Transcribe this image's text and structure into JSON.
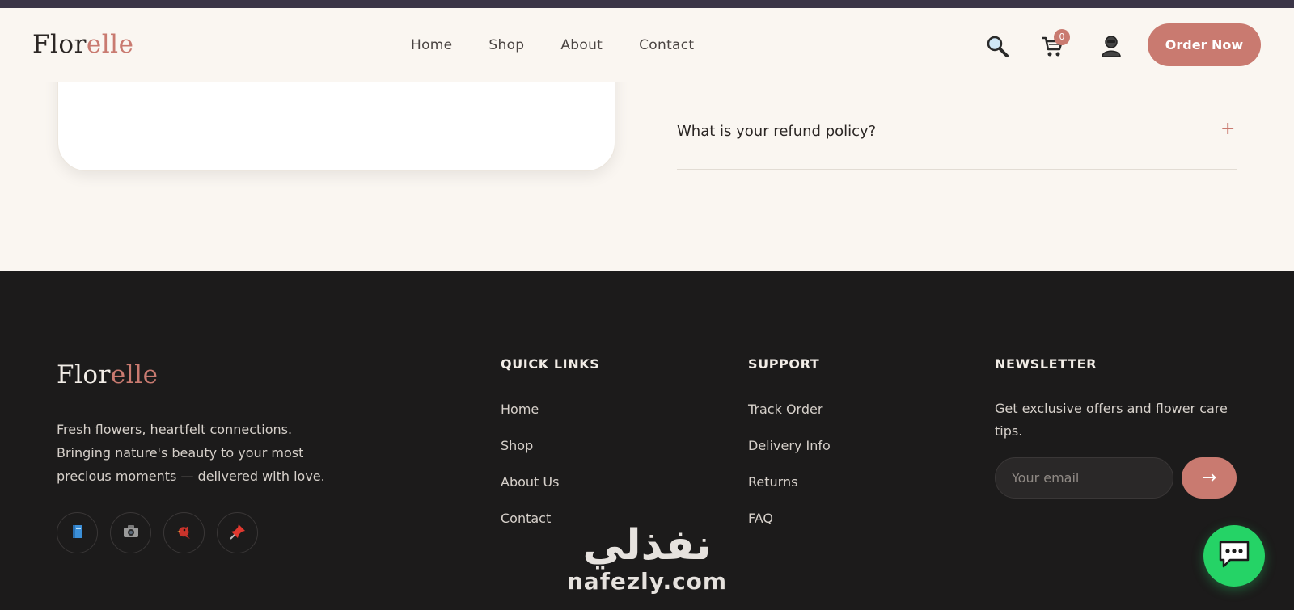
{
  "brand": {
    "logo_part1": "Flor",
    "logo_part2": "elle"
  },
  "nav": {
    "links": [
      "Home",
      "Shop",
      "About",
      "Contact"
    ],
    "cart_count": "0",
    "order_label": "Order Now",
    "icons": [
      "search-icon",
      "cart-icon",
      "user-icon"
    ]
  },
  "faq": {
    "question": "What is your refund policy?",
    "toggle": "+"
  },
  "footer": {
    "tagline": "Fresh flowers, heartfelt connections. Bringing nature's beauty to your most precious moments — delivered with love.",
    "social_icons": [
      "book-icon",
      "camera-icon",
      "bird-icon",
      "pushpin-icon"
    ],
    "quick_links": {
      "title": "QUICK LINKS",
      "items": [
        "Home",
        "Shop",
        "About Us",
        "Contact"
      ]
    },
    "support": {
      "title": "SUPPORT",
      "items": [
        "Track Order",
        "Delivery Info",
        "Returns",
        "FAQ"
      ]
    },
    "newsletter": {
      "title": "NEWSLETTER",
      "text": "Get exclusive offers and flower care tips.",
      "placeholder": "Your email",
      "submit": "→"
    }
  },
  "watermark": {
    "arabic": "نفذلي",
    "latin": "nafezly.com"
  },
  "colors": {
    "accent": "#c97a70",
    "footer_bg": "#1c1b1b",
    "page_bg": "#faf6f1",
    "chat": "#25d366"
  }
}
